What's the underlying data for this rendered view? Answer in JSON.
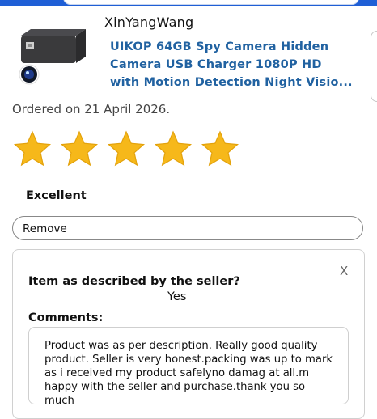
{
  "product": {
    "seller": "XinYangWang",
    "title": "UIKOP 64GB Spy Camera Hidden Camera USB Charger 1080P HD with Motion Detection Night Visio...",
    "image_icon": "usb-charger-spy-camera"
  },
  "order": {
    "ordered_text": "Ordered on 21 April 2026."
  },
  "rating": {
    "stars_filled": 5,
    "stars_total": 5,
    "label": "Excellent",
    "star_color": "#f6b81a"
  },
  "actions": {
    "remove_label": "Remove"
  },
  "feedback": {
    "close_label": "X",
    "question": "Item as described by the seller?",
    "answer": "Yes",
    "comments_label": "Comments:",
    "comments": "Product was as per description. Really good quality product. Seller is very honest.packing was up to mark as i received my product safelyno damag at all.m happy with the seller and purchase.thank you so much"
  },
  "colors": {
    "accent_top_bar": "#1f5fd6",
    "link": "#2162a1"
  }
}
